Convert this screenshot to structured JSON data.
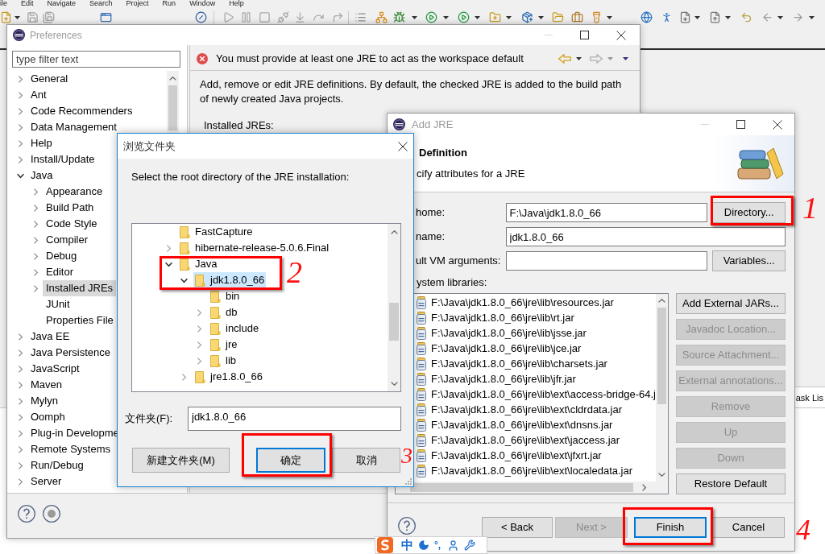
{
  "menu_bar": {
    "items": [
      "ile",
      "Edit",
      "Navigate",
      "Search",
      "Project",
      "Run",
      "Window",
      "Help"
    ]
  },
  "workbench": {
    "view_tab": "ask Lis"
  },
  "preferences": {
    "title": "Preferences",
    "filter": {
      "placeholder": "type filter text"
    },
    "tree": [
      {
        "label": "General",
        "expandable": true,
        "expanded": false,
        "selected": false
      },
      {
        "label": "Ant",
        "expandable": true,
        "expanded": false,
        "selected": false
      },
      {
        "label": "Code Recommenders",
        "expandable": true,
        "expanded": false,
        "selected": false
      },
      {
        "label": "Data Management",
        "expandable": true,
        "expanded": false,
        "selected": false
      },
      {
        "label": "Help",
        "expandable": true,
        "expanded": false,
        "selected": false
      },
      {
        "label": "Install/Update",
        "expandable": true,
        "expanded": false,
        "selected": false
      },
      {
        "label": "Java",
        "expandable": true,
        "expanded": true,
        "selected": false,
        "children": [
          {
            "label": "Appearance",
            "expandable": true,
            "expanded": false,
            "selected": false
          },
          {
            "label": "Build Path",
            "expandable": true,
            "expanded": false,
            "selected": false
          },
          {
            "label": "Code Style",
            "expandable": true,
            "expanded": false,
            "selected": false
          },
          {
            "label": "Compiler",
            "expandable": true,
            "expanded": false,
            "selected": false
          },
          {
            "label": "Debug",
            "expandable": true,
            "expanded": false,
            "selected": false
          },
          {
            "label": "Editor",
            "expandable": true,
            "expanded": false,
            "selected": false
          },
          {
            "label": "Installed JREs",
            "expandable": true,
            "expanded": false,
            "selected": true
          },
          {
            "label": "JUnit",
            "expandable": false,
            "selected": false
          },
          {
            "label": "Properties File",
            "expandable": false,
            "selected": false
          }
        ]
      },
      {
        "label": "Java EE",
        "expandable": true,
        "expanded": false,
        "selected": false
      },
      {
        "label": "Java Persistence",
        "expandable": true,
        "expanded": false,
        "selected": false
      },
      {
        "label": "JavaScript",
        "expandable": true,
        "expanded": false,
        "selected": false
      },
      {
        "label": "Maven",
        "expandable": true,
        "expanded": false,
        "selected": false
      },
      {
        "label": "Mylyn",
        "expandable": true,
        "expanded": false,
        "selected": false
      },
      {
        "label": "Oomph",
        "expandable": true,
        "expanded": false,
        "selected": false
      },
      {
        "label": "Plug-in Developme",
        "expandable": true,
        "expanded": false,
        "selected": false
      },
      {
        "label": "Remote Systems",
        "expandable": true,
        "expanded": false,
        "selected": false
      },
      {
        "label": "Run/Debug",
        "expandable": true,
        "expanded": false,
        "selected": false
      },
      {
        "label": "Server",
        "expandable": true,
        "expanded": false,
        "selected": false
      }
    ],
    "message": {
      "kind": "error",
      "text": "You must provide at least one JRE to act as the workspace default"
    },
    "description": "Add, remove or edit JRE definitions. By default, the checked JRE is added to the build path of newly created Java projects.",
    "section_label": "Installed JREs:"
  },
  "browse_dialog": {
    "title": "浏览文件夹",
    "prompt": "Select the root directory of the JRE installation:",
    "tree": [
      {
        "label": "FastCapture",
        "expandable": false,
        "selected": false
      },
      {
        "label": "hibernate-release-5.0.6.Final",
        "expandable": true,
        "expanded": false,
        "selected": false
      },
      {
        "label": "Java",
        "expandable": true,
        "expanded": true,
        "selected": false,
        "children": [
          {
            "label": "jdk1.8.0_66",
            "expandable": true,
            "expanded": true,
            "selected": true,
            "children": [
              {
                "label": "bin",
                "expandable": false,
                "selected": false
              },
              {
                "label": "db",
                "expandable": true,
                "expanded": false,
                "selected": false
              },
              {
                "label": "include",
                "expandable": true,
                "expanded": false,
                "selected": false
              },
              {
                "label": "jre",
                "expandable": true,
                "expanded": false,
                "selected": false
              },
              {
                "label": "lib",
                "expandable": true,
                "expanded": false,
                "selected": false
              }
            ]
          },
          {
            "label": "jre1.8.0_66",
            "expandable": true,
            "expanded": false,
            "selected": false
          }
        ]
      }
    ],
    "folder": {
      "label": "文件夹(F):",
      "value": "jdk1.8.0_66"
    },
    "buttons": [
      {
        "label": "新建文件夹(M)",
        "focused": false
      },
      {
        "label": "确定",
        "focused": true
      },
      {
        "label": "取消",
        "focused": false
      }
    ]
  },
  "add_jre": {
    "title": "Add JRE",
    "heading": "Definition",
    "subheading": "cify attributes for a JRE",
    "fields": [
      {
        "label": "home:",
        "value": "F:\\Java\\jdk1.8.0_66",
        "button": "Directory..."
      },
      {
        "label": "name:",
        "value": "jdk1.8.0_66"
      },
      {
        "label": "ult VM arguments:",
        "button": "Variables..."
      }
    ],
    "libraries_label": "ystem libraries:",
    "libraries": [
      "F:\\Java\\jdk1.8.0_66\\jre\\lib\\resources.jar",
      "F:\\Java\\jdk1.8.0_66\\jre\\lib\\rt.jar",
      "F:\\Java\\jdk1.8.0_66\\jre\\lib\\jsse.jar",
      "F:\\Java\\jdk1.8.0_66\\jre\\lib\\jce.jar",
      "F:\\Java\\jdk1.8.0_66\\jre\\lib\\charsets.jar",
      "F:\\Java\\jdk1.8.0_66\\jre\\lib\\jfr.jar",
      "F:\\Java\\jdk1.8.0_66\\jre\\lib\\ext\\access-bridge-64.j",
      "F:\\Java\\jdk1.8.0_66\\jre\\lib\\ext\\cldrdata.jar",
      "F:\\Java\\jdk1.8.0_66\\jre\\lib\\ext\\dnsns.jar",
      "F:\\Java\\jdk1.8.0_66\\jre\\lib\\ext\\jaccess.jar",
      "F:\\Java\\jdk1.8.0_66\\jre\\lib\\ext\\jfxrt.jar",
      "F:\\Java\\jdk1.8.0_66\\jre\\lib\\ext\\localedata.jar"
    ],
    "side_buttons": [
      {
        "label": "Add External JARs...",
        "disabled": false
      },
      {
        "label": "Javadoc Location...",
        "disabled": true
      },
      {
        "label": "Source Attachment...",
        "disabled": true
      },
      {
        "label": "External annotations...",
        "disabled": true
      },
      {
        "label": "Remove",
        "disabled": true
      },
      {
        "label": "Up",
        "disabled": true
      },
      {
        "label": "Down",
        "disabled": true
      },
      {
        "label": "Restore Default",
        "disabled": false
      }
    ],
    "footer_buttons": [
      {
        "label": "< Back",
        "disabled": false,
        "focused": false
      },
      {
        "label": "Next >",
        "disabled": true,
        "focused": false
      },
      {
        "label": "Finish",
        "disabled": false,
        "focused": true
      },
      {
        "label": "Cancel",
        "disabled": false,
        "focused": false
      }
    ]
  },
  "annotations": [
    {
      "number": "1"
    },
    {
      "number": "2"
    },
    {
      "number": "3"
    },
    {
      "number": "4"
    }
  ],
  "ime_bar": {
    "mode": "中",
    "punctuation": "°,"
  }
}
